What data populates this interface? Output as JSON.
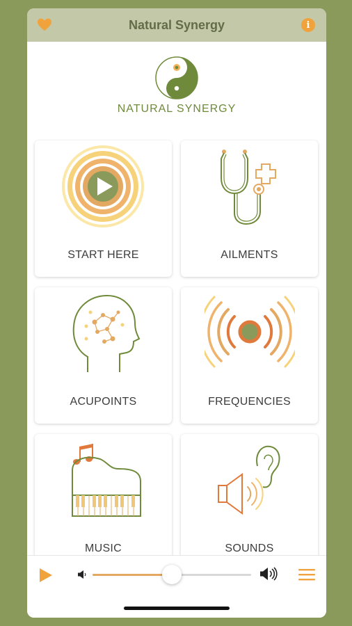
{
  "header": {
    "title": "Natural Synergy",
    "favorite_icon": "heart-icon",
    "info_icon": "info-icon",
    "info_glyph": "i"
  },
  "brand": {
    "name": "NATURAL SYNERGY",
    "logo_icon": "yin-yang-logo"
  },
  "cards": [
    {
      "label": "START HERE",
      "icon": "play-circles-icon"
    },
    {
      "label": "AILMENTS",
      "icon": "stethoscope-icon"
    },
    {
      "label": "ACUPOINTS",
      "icon": "head-acupoints-icon"
    },
    {
      "label": "FREQUENCIES",
      "icon": "frequency-waves-icon"
    },
    {
      "label": "MUSIC",
      "icon": "piano-icon"
    },
    {
      "label": "SOUNDS",
      "icon": "speaker-ear-icon"
    }
  ],
  "player": {
    "play_icon": "play-icon",
    "volume_low_icon": "volume-low-icon",
    "volume_high_icon": "volume-high-icon",
    "menu_icon": "hamburger-menu-icon",
    "volume_level": 0.5
  },
  "colors": {
    "background": "#8a9a5b",
    "header_bg": "#c3c9a8",
    "accent_orange": "#f0a33c",
    "olive": "#6e8a3a"
  }
}
